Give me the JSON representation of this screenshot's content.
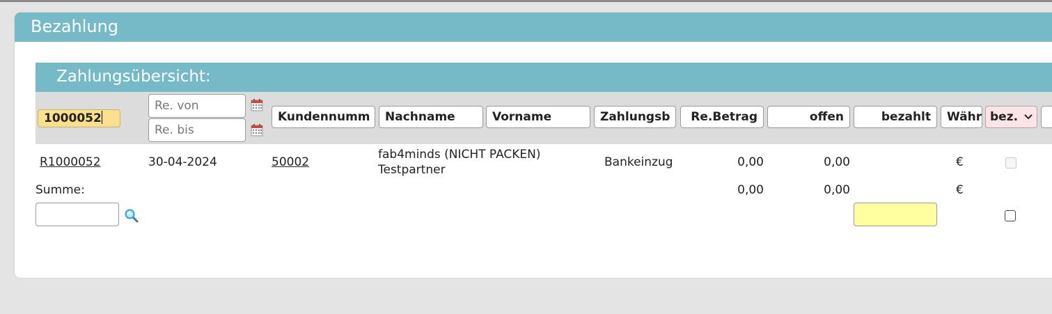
{
  "panel": {
    "title": "Bezahlung"
  },
  "overview": {
    "title": "Zahlungsübersicht:"
  },
  "filters": {
    "invoice_number": "1000052",
    "date_from_placeholder": "Re. von",
    "date_to_placeholder": "Re. bis",
    "kundennummer": "Kundennumm",
    "nachname": "Nachname",
    "vorname": "Vorname",
    "zahlungsart": "Zahlungsb",
    "re_betrag": "Re.Betrag",
    "offen": "offen",
    "bezahlt": "bezahlt",
    "waehrung": "Währ",
    "status_select": "bez."
  },
  "rows": [
    {
      "invoice": "R1000052",
      "date": "30-04-2024",
      "customer_number": "50002",
      "name_line1": "fab4minds (NICHT PACKEN)",
      "name_line2": "Testpartner",
      "payment_method": "Bankeinzug",
      "amount": "0,00",
      "open": "0,00",
      "currency": "€"
    }
  ],
  "summary": {
    "label": "Summe:",
    "amount": "0,00",
    "open": "0,00",
    "currency": "€"
  },
  "icons": {
    "calendar": "calendar-icon",
    "search": "search-icon",
    "dropdown": "chevron-down-icon"
  },
  "colors": {
    "header": "#76bac8",
    "filter_bar": "#dcdcdc",
    "invoice_filter": "#fae08c",
    "paid_input": "#ffff9f",
    "status_select": "#fbe3e6",
    "calendar": "#d9443a"
  }
}
